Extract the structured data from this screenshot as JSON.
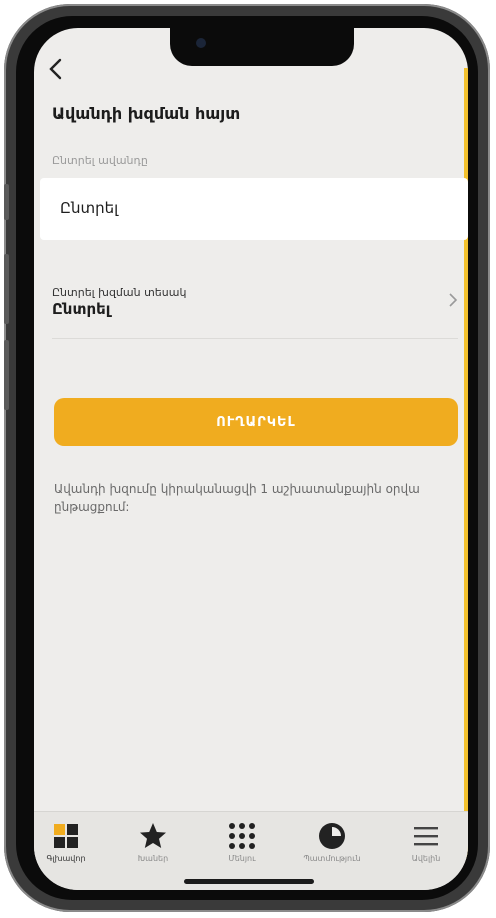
{
  "header": {
    "back_icon": "chevron-left-icon",
    "title": "Ավանդի խզման հայտ"
  },
  "deposit_field": {
    "label": "Ընտրել ավանդը",
    "value": "Ընտրել"
  },
  "termination_type": {
    "label": "Ընտրել խզման տեսակ",
    "value": "Ընտրել"
  },
  "send_button": {
    "label": "ՈՒՂԱՐԿԵԼ"
  },
  "note": "Ավանդի խզումը կիրականացվի 1 աշխատանքային օրվա ընթացքում:",
  "colors": {
    "accent": "#f0ac1f",
    "background": "#eeedeb",
    "tabbar": "#e6e5e2"
  },
  "tabs": [
    {
      "label": "Գլխավոր",
      "icon": "grid-icon",
      "active": true
    },
    {
      "label": "Խաներ",
      "icon": "star-icon",
      "active": false
    },
    {
      "label": "Մենյու",
      "icon": "dots-grid-icon",
      "active": false
    },
    {
      "label": "Պատմություն",
      "icon": "clock-icon",
      "active": false
    },
    {
      "label": "Ավելին",
      "icon": "menu-icon",
      "active": false
    }
  ]
}
